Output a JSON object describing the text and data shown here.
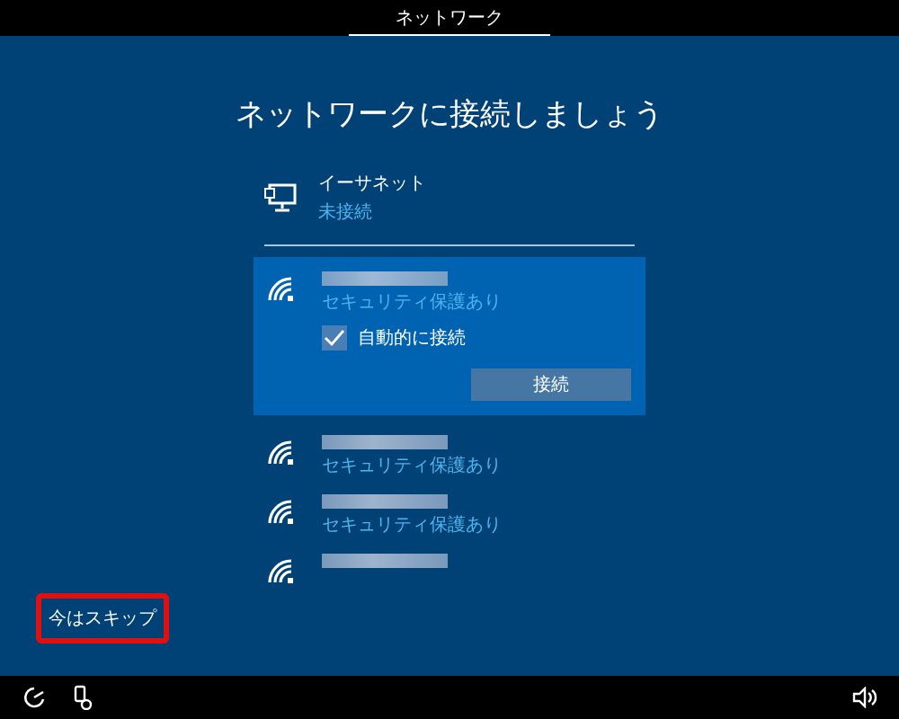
{
  "top_bar": {
    "title": "ネットワーク"
  },
  "heading": "ネットワークに接続しましょう",
  "ethernet": {
    "name": "イーサネット",
    "status": "未接続"
  },
  "networks": [
    {
      "selected": true,
      "security": "セキュリティ保護あり",
      "auto_connect": {
        "label": "自動的に接続",
        "checked": true
      },
      "connect_button": "接続"
    },
    {
      "selected": false,
      "security": "セキュリティ保護あり"
    },
    {
      "selected": false,
      "security": "セキュリティ保護あり"
    },
    {
      "selected": false
    }
  ],
  "skip_button": {
    "label": "今はスキップ",
    "highlighted": true
  }
}
